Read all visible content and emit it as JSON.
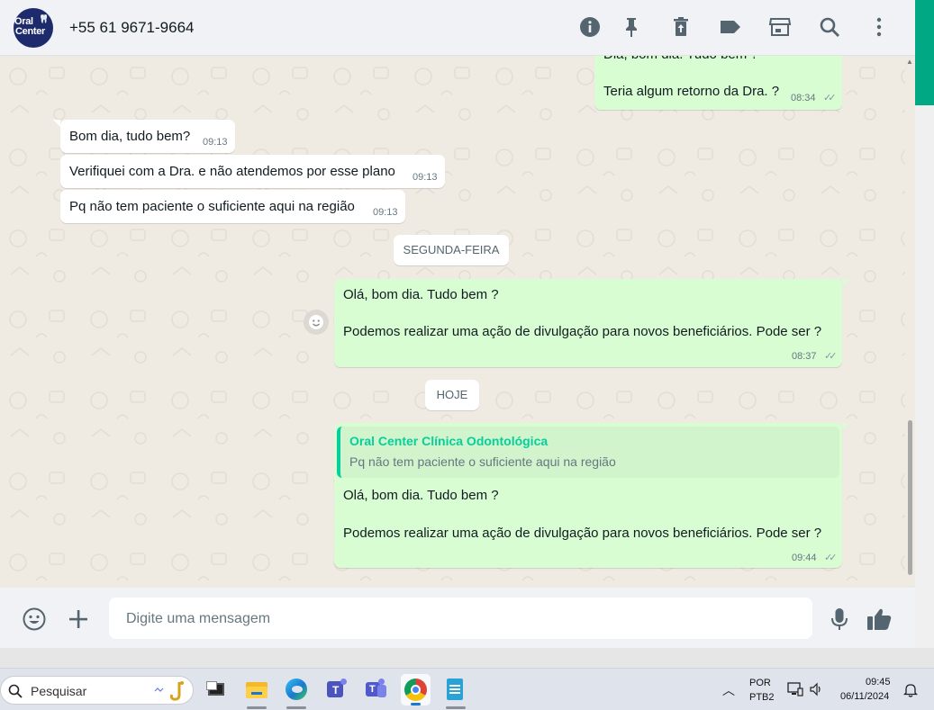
{
  "header": {
    "avatar_line1": "Oral",
    "avatar_line2": "Center",
    "contact_name": "+55 61 9671-9664",
    "icons": [
      "info-icon",
      "pin-icon",
      "trash-icon",
      "label-icon",
      "store-icon",
      "search-icon",
      "more-icon"
    ]
  },
  "messages": [
    {
      "dir": "out",
      "text": "Dia, bom dia. Tudo bem ?",
      "clipped": true
    },
    {
      "dir": "out",
      "text": "Teria algum retorno da Dra. ?",
      "time": "08:34",
      "ticks": "✓✓"
    },
    {
      "dir": "in",
      "text": "Bom dia, tudo bem?",
      "time": "09:13"
    },
    {
      "dir": "in",
      "text": "Verifiquei com a Dra. e não atendemos por esse plano",
      "time": "09:13"
    },
    {
      "dir": "in",
      "text": "Pq não tem paciente o suficiente aqui na região",
      "time": "09:13"
    },
    {
      "dir": "out",
      "line1": "Olá, bom dia. Tudo bem ?",
      "line2": "Podemos realizar uma ação de divulgação para novos beneficiários. Pode ser ?",
      "time": "08:37",
      "ticks": "✓✓"
    },
    {
      "dir": "out",
      "quote_name": "Oral Center Clínica Odontológica",
      "quote_text": "Pq não tem paciente o suficiente aqui na região",
      "line1": "Olá, bom dia. Tudo bem ?",
      "line2": "Podemos realizar uma ação de divulgação para novos beneficiários. Pode ser ?",
      "time": "09:44",
      "ticks": "✓✓"
    }
  ],
  "day_separators": [
    "SEGUNDA-FEIRA",
    "HOJE"
  ],
  "composer": {
    "placeholder": "Digite uma mensagem",
    "icons": [
      "emoji-icon",
      "plus-icon",
      "mic-icon",
      "thumbs-up-icon"
    ]
  },
  "taskbar": {
    "search_placeholder": "Pesquisar",
    "apps": [
      "task-view",
      "file-explorer",
      "edge",
      "teams-personal",
      "teams-work",
      "chrome",
      "notepad"
    ],
    "lang_line1": "POR",
    "lang_line2": "PTB2",
    "time": "09:45",
    "date": "06/11/2024"
  },
  "colors": {
    "accent": "#00a884",
    "outgoing_bubble": "#d9fdd3",
    "incoming_bubble": "#ffffff",
    "chat_bg": "#efeae2",
    "quote_name": "#06cf9c"
  }
}
